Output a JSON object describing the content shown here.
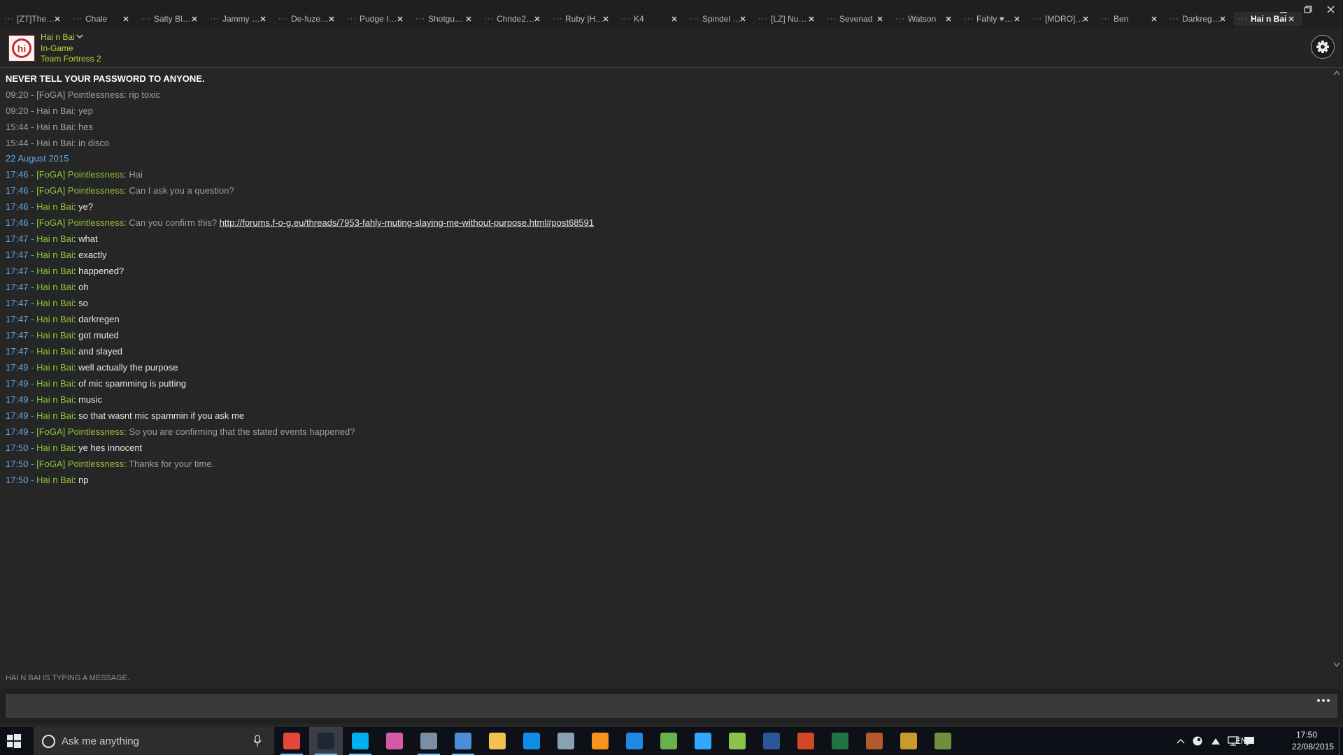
{
  "window": {
    "tabs": [
      {
        "label": "[ZT]The D...",
        "close": true
      },
      {
        "label": "Chale",
        "close": true
      },
      {
        "label": "Salty Blan...",
        "close": true
      },
      {
        "label": "Jammy D...",
        "close": true
      },
      {
        "label": "De-fuze is...",
        "close": true
      },
      {
        "label": "Pudge Is F...",
        "close": true
      },
      {
        "label": "Shotgun_...",
        "close": true
      },
      {
        "label": "Chride2k8...",
        "close": true
      },
      {
        "label": "Ruby |Hiv...",
        "close": true
      },
      {
        "label": "K4",
        "close": true
      },
      {
        "label": "Spindel th...",
        "close": true
      },
      {
        "label": "[LZ] NuM...",
        "close": true
      },
      {
        "label": "Sevenad",
        "close": true
      },
      {
        "label": "Watson",
        "close": true
      },
      {
        "label": "Fahly ♥M...",
        "close": true
      },
      {
        "label": "[MDRO]M...",
        "close": true
      },
      {
        "label": "Ben",
        "close": true
      },
      {
        "label": "Darkregen",
        "close": true
      },
      {
        "label": "Hai n Bai",
        "close": true,
        "active": true
      }
    ],
    "controls": {
      "minimize": "minimize-icon",
      "restore": "restore-icon",
      "close": "close-icon"
    }
  },
  "friend": {
    "name": "Hai n Bai",
    "status": "In-Game",
    "game": "Team Fortress 2",
    "avatar_icon": "hi-avatar-icon",
    "name_color": "#b5d63a"
  },
  "chat": {
    "notice": "NEVER TELL YOUR PASSWORD TO ANYONE.",
    "history": [
      "09:20 - [FoGA] Pointlessness: rip toxic",
      "09:20 - Hai n Bai: yep",
      "15:44 - Hai n Bai: hes",
      "15:44 - Hai n Bai: in disco"
    ],
    "date_header": "22 August 2015",
    "messages": [
      {
        "time": "17:46",
        "sender": "[FoGA] Pointlessness",
        "own": false,
        "text": "Hai"
      },
      {
        "time": "17:46",
        "sender": "[FoGA] Pointlessness",
        "own": false,
        "text": "Can I ask you a question?"
      },
      {
        "time": "17:46",
        "sender": "Hai n Bai",
        "own": true,
        "text": "ye?"
      },
      {
        "time": "17:46",
        "sender": "[FoGA] Pointlessness",
        "own": false,
        "text": "Can you confirm this? ",
        "link": "http://forums.f-o-g.eu/threads/7953-fahly-muting-slaying-me-without-purpose.html#post68591"
      },
      {
        "time": "17:47",
        "sender": "Hai n Bai",
        "own": true,
        "text": "what"
      },
      {
        "time": "17:47",
        "sender": "Hai n Bai",
        "own": true,
        "text": "exactly"
      },
      {
        "time": "17:47",
        "sender": "Hai n Bai",
        "own": true,
        "text": "happened?"
      },
      {
        "time": "17:47",
        "sender": "Hai n Bai",
        "own": true,
        "text": "oh"
      },
      {
        "time": "17:47",
        "sender": "Hai n Bai",
        "own": true,
        "text": "so"
      },
      {
        "time": "17:47",
        "sender": "Hai n Bai",
        "own": true,
        "text": "darkregen"
      },
      {
        "time": "17:47",
        "sender": "Hai n Bai",
        "own": true,
        "text": "got muted"
      },
      {
        "time": "17:47",
        "sender": "Hai n Bai",
        "own": true,
        "text": "and slayed"
      },
      {
        "time": "17:49",
        "sender": "Hai n Bai",
        "own": true,
        "text": "well actually the purpose"
      },
      {
        "time": "17:49",
        "sender": "Hai n Bai",
        "own": true,
        "text": "of mic spamming is putting"
      },
      {
        "time": "17:49",
        "sender": "Hai n Bai",
        "own": true,
        "text": "music"
      },
      {
        "time": "17:49",
        "sender": "Hai n Bai",
        "own": true,
        "text": "so that wasnt mic spammin if you ask me"
      },
      {
        "time": "17:49",
        "sender": "[FoGA] Pointlessness",
        "own": false,
        "text": "So you are confirming that the stated events happened?"
      },
      {
        "time": "17:50",
        "sender": "Hai n Bai",
        "own": true,
        "text": "ye hes innocent"
      },
      {
        "time": "17:50",
        "sender": "[FoGA] Pointlessness",
        "own": false,
        "text": "Thanks for your time."
      },
      {
        "time": "17:50",
        "sender": "Hai n Bai",
        "own": true,
        "text": "np"
      }
    ],
    "typing_status": "HAI N BAI IS TYPING A MESSAGE.",
    "input_value": "",
    "colors": {
      "timestamp": "#62a8e8",
      "friend_name": "#8fc43a",
      "own_text": "#e6e6e6",
      "other_text": "#9e9e9e"
    }
  },
  "taskbar": {
    "search_placeholder": "Ask me anything",
    "apps": [
      {
        "name": "chrome-icon",
        "color": "#e8453c",
        "running": true
      },
      {
        "name": "steam-icon",
        "color": "#1b2838",
        "running": true,
        "active": true
      },
      {
        "name": "skype-icon",
        "color": "#00aff0",
        "running": true
      },
      {
        "name": "itunes-icon",
        "color": "#d55aa6",
        "running": false
      },
      {
        "name": "mail-icon",
        "color": "#7a8fa6",
        "running": true
      },
      {
        "name": "word-document-icon",
        "color": "#4a90d9",
        "running": true
      },
      {
        "name": "file-explorer-icon",
        "color": "#f2c14e",
        "running": false
      },
      {
        "name": "teamviewer-icon",
        "color": "#0e8ee9",
        "running": false
      },
      {
        "name": "teamspeak-icon",
        "color": "#8aa0b5",
        "running": false
      },
      {
        "name": "avast-icon",
        "color": "#f7941d",
        "running": false
      },
      {
        "name": "malwarebytes-icon",
        "color": "#1e88e5",
        "running": false
      },
      {
        "name": "utorrent-icon",
        "color": "#6ab04c",
        "running": false
      },
      {
        "name": "photoshop-icon",
        "color": "#31a8ff",
        "running": false
      },
      {
        "name": "notepad-icon",
        "color": "#8bc34a",
        "running": false
      },
      {
        "name": "word-icon",
        "color": "#2b579a",
        "running": false
      },
      {
        "name": "powerpoint-icon",
        "color": "#d24726",
        "running": false
      },
      {
        "name": "excel-icon",
        "color": "#217346",
        "running": false
      },
      {
        "name": "team-fortress-icon",
        "color": "#b35a2d",
        "running": false
      },
      {
        "name": "keygen-icon",
        "color": "#c89b2a",
        "running": false
      },
      {
        "name": "minecraft-icon",
        "color": "#6f8f3a",
        "running": false
      }
    ],
    "tray": {
      "language": "ENG",
      "time": "17:50",
      "date": "22/08/2015"
    }
  }
}
